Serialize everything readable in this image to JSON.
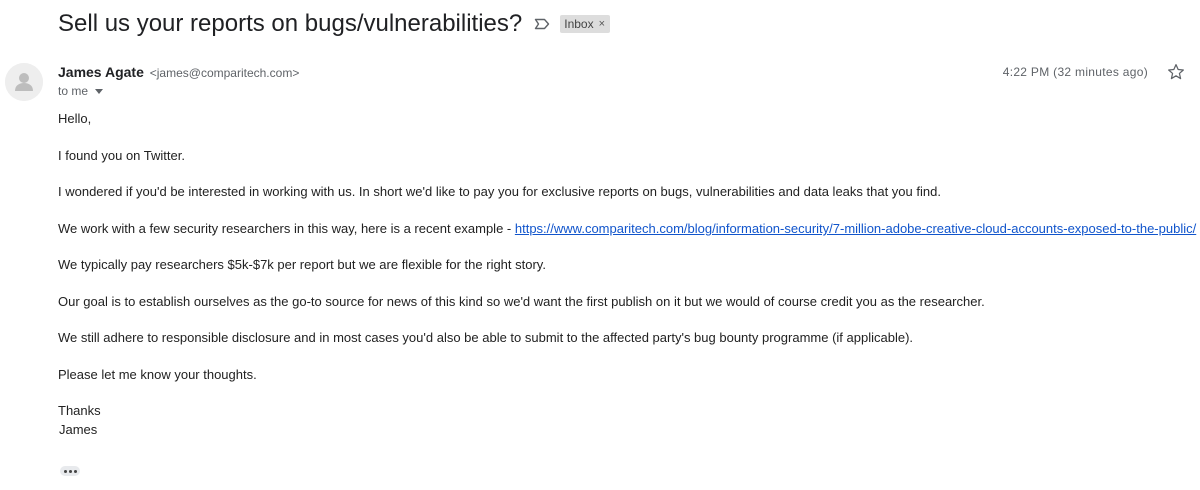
{
  "email": {
    "subject": "Sell us your reports on bugs/vulnerabilities?",
    "label": "Inbox",
    "label_close": "×",
    "sender_name": "James Agate",
    "sender_email": "<james@comparitech.com>",
    "recipient": "to me",
    "timestamp": "4:22 PM (32 minutes ago)",
    "body": {
      "greeting": "Hello,",
      "p1": "I found you on Twitter.",
      "p2": "I wondered if you'd be interested in working with us. In short we'd like to pay you for exclusive reports on bugs, vulnerabilities and data leaks that you find.",
      "p3_prefix": "We work with a few security researchers in this way, here is a recent example - ",
      "p3_link": "https://www.comparitech.com/blog/information-security/7-million-adobe-creative-cloud-accounts-exposed-to-the-public/",
      "p4": "We typically pay researchers $5k-$7k per report but we are flexible for the right story.",
      "p5": "Our goal is to establish ourselves as the go-to source for news of this kind so we'd want the first publish on it but we would of course credit you as the researcher.",
      "p6": "We still adhere to responsible disclosure and in most cases you'd also be able to submit to the affected party's bug bounty programme (if applicable).",
      "p7": "Please let me know your thoughts.",
      "signoff": "Thanks",
      "signature": "James"
    }
  },
  "icons": {
    "important_marker": "label-outline-icon",
    "avatar": "default-avatar-icon",
    "star": "star-outline-icon",
    "recipient_caret": "caret-down-icon",
    "show_trimmed": "ellipsis-icon"
  },
  "colors": {
    "link": "#1155cc",
    "chip_background": "#dddddd",
    "secondary_text": "#5f6368"
  }
}
